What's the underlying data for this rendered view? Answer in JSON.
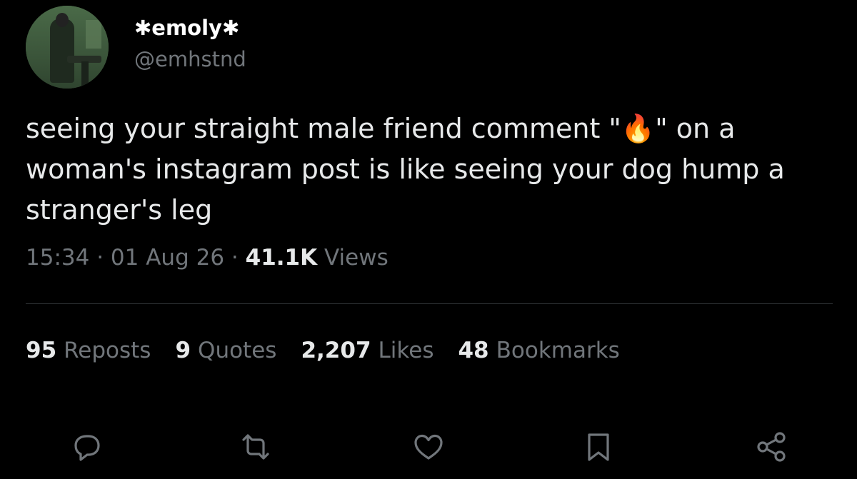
{
  "author": {
    "display_name": "✱emoly✱",
    "handle": "@emhstnd"
  },
  "tweet": {
    "text_before": "seeing your straight male friend comment \"",
    "emoji": "🔥",
    "text_after": "\" on a woman's instagram post is like seeing your dog hump a stranger's leg"
  },
  "meta": {
    "time": "15:34",
    "sep1": "·",
    "date": "01 Aug 26",
    "sep2": "·",
    "views_count": "41.1K",
    "views_label": "Views"
  },
  "stats": [
    {
      "num": "95",
      "label": "Reposts"
    },
    {
      "num": "9",
      "label": "Quotes"
    },
    {
      "num": "2,207",
      "label": "Likes"
    },
    {
      "num": "48",
      "label": "Bookmarks"
    }
  ],
  "actions": {
    "icons": [
      "reply-icon",
      "repost-icon",
      "like-icon",
      "bookmark-icon",
      "share-icon"
    ]
  },
  "colors": {
    "background": "#000000",
    "text": "#e7e9ea",
    "secondary": "#71767b",
    "divider": "#2f3336"
  }
}
